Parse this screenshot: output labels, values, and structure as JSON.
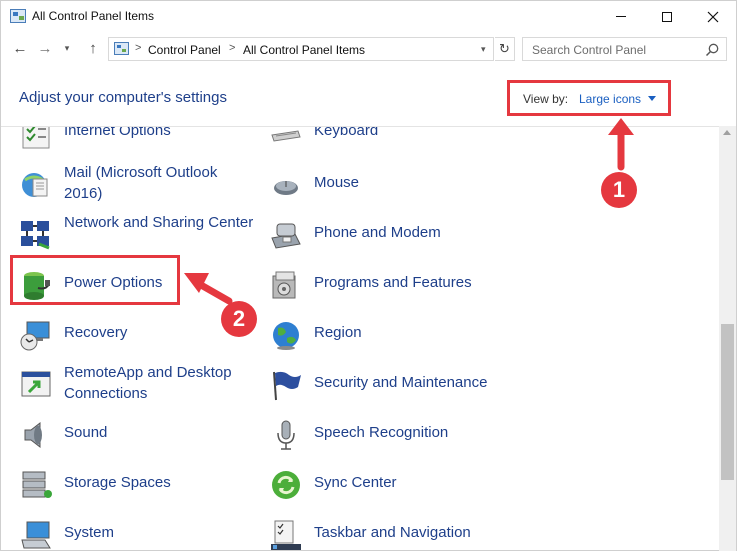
{
  "window": {
    "title": "All Control Panel Items",
    "icons": {
      "app": "control-panel-icon",
      "minimize": "minimize-icon",
      "maximize": "maximize-icon",
      "close": "close-icon"
    }
  },
  "nav": {
    "back": "←",
    "forward": "→",
    "recent": "▾",
    "up": "↑",
    "breadcrumb": [
      "Control Panel",
      "All Control Panel Items"
    ],
    "separator": ">",
    "refresh": "↻",
    "search_placeholder": "Search Control Panel"
  },
  "header": {
    "title": "Adjust your computer's settings",
    "view_by_label": "View by:",
    "view_by_value": "Large icons"
  },
  "items": [
    {
      "label": "Internet Options",
      "icon": "internet-options-icon"
    },
    {
      "label": "Keyboard",
      "icon": "keyboard-icon"
    },
    {
      "label": "Mail (Microsoft Outlook 2016)",
      "icon": "mail-icon"
    },
    {
      "label": "Mouse",
      "icon": "mouse-icon"
    },
    {
      "label": "Network and Sharing Center",
      "icon": "network-icon"
    },
    {
      "label": "Phone and Modem",
      "icon": "phone-icon"
    },
    {
      "label": "Power Options",
      "icon": "power-icon"
    },
    {
      "label": "Programs and Features",
      "icon": "programs-icon"
    },
    {
      "label": "Recovery",
      "icon": "recovery-icon"
    },
    {
      "label": "Region",
      "icon": "region-icon"
    },
    {
      "label": "RemoteApp and Desktop Connections",
      "icon": "remoteapp-icon"
    },
    {
      "label": "Security and Maintenance",
      "icon": "security-flag-icon"
    },
    {
      "label": "Sound",
      "icon": "sound-icon"
    },
    {
      "label": "Speech Recognition",
      "icon": "microphone-icon"
    },
    {
      "label": "Storage Spaces",
      "icon": "storage-icon"
    },
    {
      "label": "Sync Center",
      "icon": "sync-icon"
    },
    {
      "label": "System",
      "icon": "system-icon"
    },
    {
      "label": "Taskbar and Navigation",
      "icon": "taskbar-icon"
    }
  ],
  "annotations": {
    "step1": "1",
    "step2": "2",
    "color": "#e5383f"
  },
  "colors": {
    "link": "#1e3f8a",
    "accent": "#1a5fc1"
  }
}
